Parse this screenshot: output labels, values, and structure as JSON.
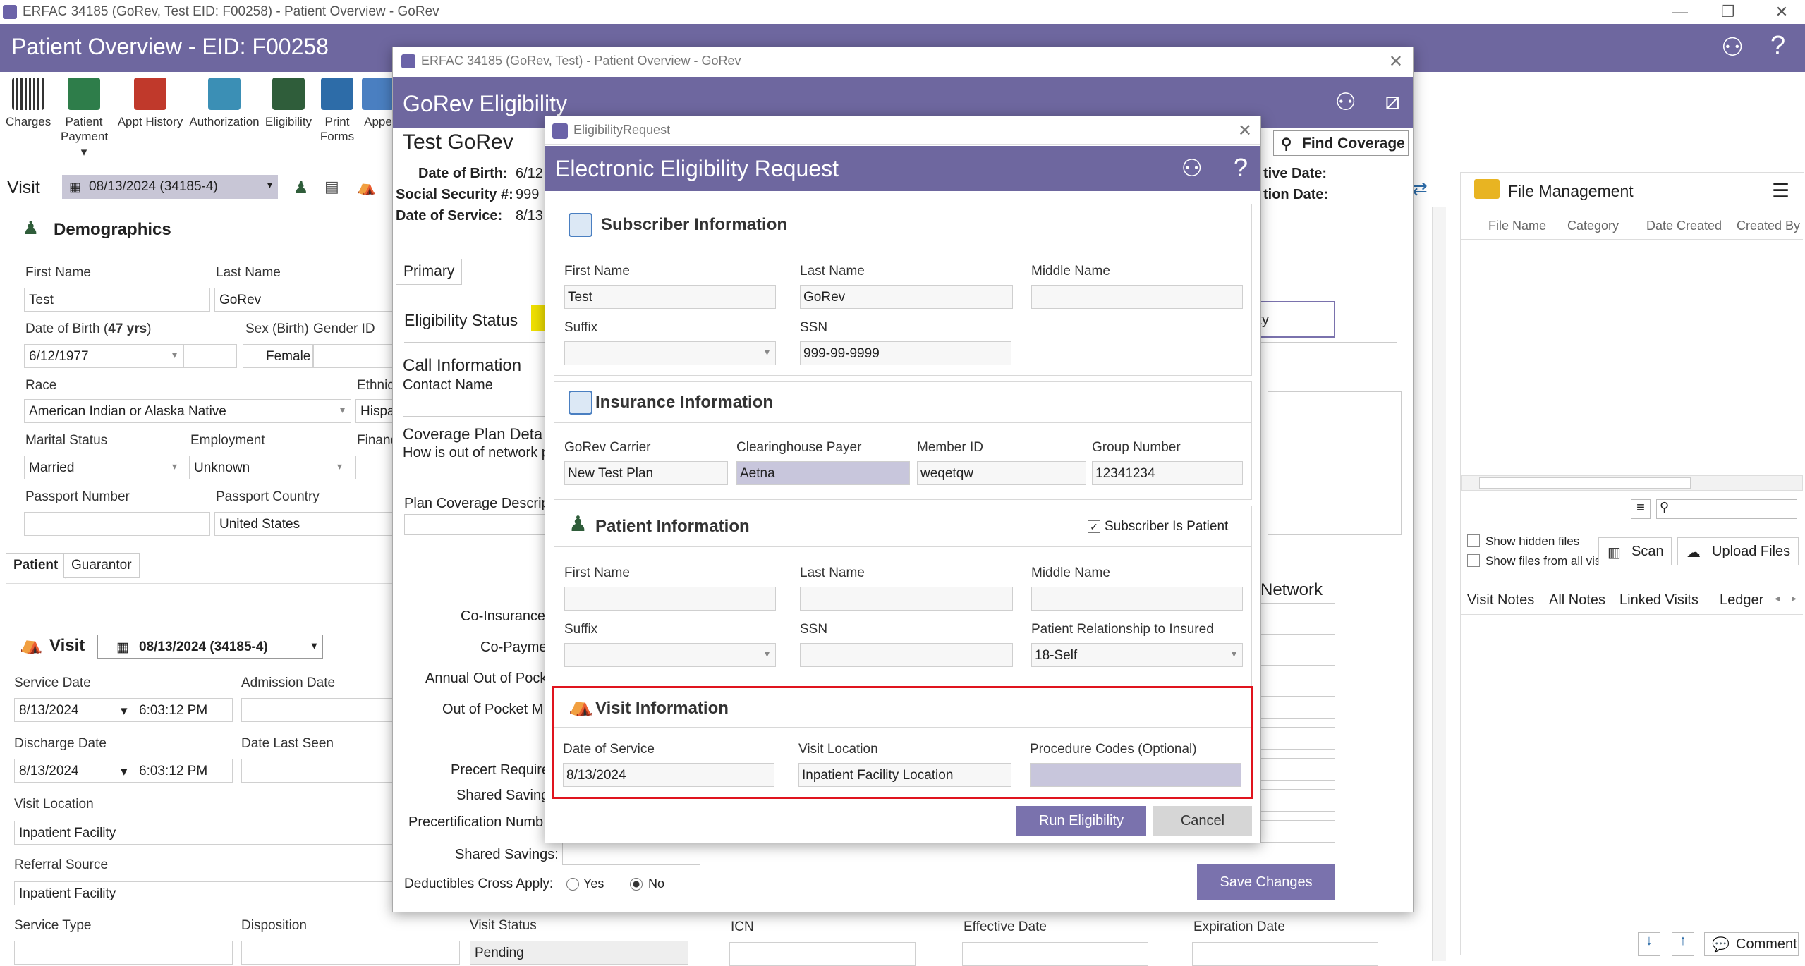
{
  "window": {
    "title": "ERFAC 34185 (GoRev, Test EID: F00258) - Patient Overview - GoRev"
  },
  "banner": {
    "title": "Patient Overview - EID: F00258"
  },
  "toolbar": [
    {
      "label": "Charges",
      "label2": ""
    },
    {
      "label": "Patient",
      "label2": "Payment ▾"
    },
    {
      "label": "Appt History",
      "label2": ""
    },
    {
      "label": "Authorization",
      "label2": ""
    },
    {
      "label": "Eligibility",
      "label2": ""
    },
    {
      "label": "Print",
      "label2": "Forms"
    },
    {
      "label": "Appe",
      "label2": ""
    }
  ],
  "visit_bar": {
    "label": "Visit",
    "selected": "08/13/2024 (34185-4)"
  },
  "demographics": {
    "title": "Demographics",
    "first_name_label": "First Name",
    "first_name": "Test",
    "last_name_label": "Last Name",
    "last_name": "GoRev",
    "dob_label": "Date of Birth (",
    "dob_age": "47 yrs",
    "dob_close": ")",
    "dob": "6/12/1977",
    "sex_label": "Sex (Birth)",
    "gender_label": "Gender ID",
    "sex": "Female",
    "race_label": "Race",
    "race": "American Indian or Alaska Native",
    "ethnic_label": "Ethnic",
    "ethnic": "Hispa",
    "marital_label": "Marital Status",
    "marital": "Married",
    "employment_label": "Employment",
    "employment": "Unknown",
    "finance_label": "Financ",
    "passport_label": "Passport Number",
    "passport_country_label": "Passport Country",
    "passport_country": "United States",
    "tabs": [
      "Patient",
      "Guarantor"
    ]
  },
  "visit_section": {
    "title": "Visit",
    "selected": "08/13/2024 (34185-4)",
    "service_date_label": "Service Date",
    "service_date": "8/13/2024",
    "service_time": "6:03:12 PM",
    "admission_label": "Admission Date",
    "discharge_label": "Discharge Date",
    "discharge_date": "8/13/2024",
    "discharge_time": "6:03:12 PM",
    "last_seen_label": "Date Last Seen",
    "location_label": "Visit Location",
    "location": "Inpatient Facility",
    "referral_label": "Referral Source",
    "referral": "Inpatient Facility",
    "service_type_label": "Service Type",
    "disposition_label": "Disposition",
    "visit_status_label": "Visit Status",
    "visit_status": "Pending"
  },
  "file_mgmt": {
    "title": "File Management",
    "columns": [
      "File Name",
      "Category",
      "Date Created",
      "Created By"
    ],
    "show_hidden": "Show hidden files",
    "show_all": "Show files from all visits",
    "scan": "Scan",
    "upload": "Upload Files",
    "tabs": [
      "Visit Notes",
      "All Notes",
      "Linked Visits",
      "Ledger"
    ],
    "comment": "Comment"
  },
  "elig_window": {
    "title": "ERFAC 34185 (GoRev, Test) - Patient Overview - GoRev",
    "banner": "GoRev Eligibility",
    "patient_name": "Test GoRev",
    "dob_label": "Date of Birth:",
    "dob_val": "6/12",
    "ssn_label": "Social Security #:",
    "ssn_val": "999",
    "dos_label": "Date of Service:",
    "dos_val": "8/13",
    "find_coverage": "Find Coverage",
    "effective_label": "tive Date:",
    "expiration_label": "tion Date:",
    "tab_primary": "Primary",
    "elig_status_label": "Eligibility Status",
    "eligibility_btn_partial": "ity",
    "call_info": "Call Information",
    "contact_name": "Contact Name",
    "coverage_plan": "Coverage Plan Deta",
    "out_of_network": "How is out of network p",
    "plan_coverage_desc": "Plan Coverage Descript",
    "network_label": "Network",
    "co_insurance": "Co-Insurance",
    "co_payment": "Co-Payme",
    "annual_oop": "Annual Out of Pock",
    "oop_max": "Out of Pocket M",
    "precert_req": "Precert Require",
    "shared_saving": "Shared Saving",
    "precert_num": "Precertification Numb",
    "shared_savings": "Shared Savings:",
    "deductibles_cross": "Deductibles Cross Apply:",
    "yes": "Yes",
    "no": "No",
    "save_changes": "Save Changes",
    "icn": "ICN",
    "effective_date": "Effective Date",
    "expiration_date": "Expiration Date"
  },
  "dialog": {
    "title": "EligibilityRequest",
    "banner": "Electronic Eligibility Request",
    "subscriber": {
      "title": "Subscriber Information",
      "first_name_label": "First Name",
      "first_name": "Test",
      "last_name_label": "Last Name",
      "last_name": "GoRev",
      "middle_name_label": "Middle Name",
      "middle_name": "",
      "suffix_label": "Suffix",
      "suffix": "",
      "ssn_label": "SSN",
      "ssn": "999-99-9999"
    },
    "insurance": {
      "title": "Insurance Information",
      "carrier_label": "GoRev Carrier",
      "carrier": "New Test Plan",
      "payer_label": "Clearinghouse Payer",
      "payer": "Aetna",
      "member_label": "Member ID",
      "member": "weqetqw",
      "group_label": "Group Number",
      "group": "12341234"
    },
    "patient": {
      "title": "Patient Information",
      "subscriber_is_patient": "Subscriber Is Patient",
      "first_name_label": "First Name",
      "last_name_label": "Last Name",
      "middle_name_label": "Middle Name",
      "suffix_label": "Suffix",
      "ssn_label": "SSN",
      "relationship_label": "Patient Relationship to Insured",
      "relationship": "18-Self"
    },
    "visit": {
      "title": "Visit Information",
      "dos_label": "Date of Service",
      "dos": "8/13/2024",
      "location_label": "Visit Location",
      "location": "Inpatient Facility Location",
      "procedure_label": "Procedure Codes (Optional)",
      "procedure": ""
    },
    "run": "Run Eligibility",
    "cancel": "Cancel"
  },
  "colors": {
    "brand": "#6e679f",
    "highlight": "#e0141e",
    "button": "#7a72ad"
  }
}
